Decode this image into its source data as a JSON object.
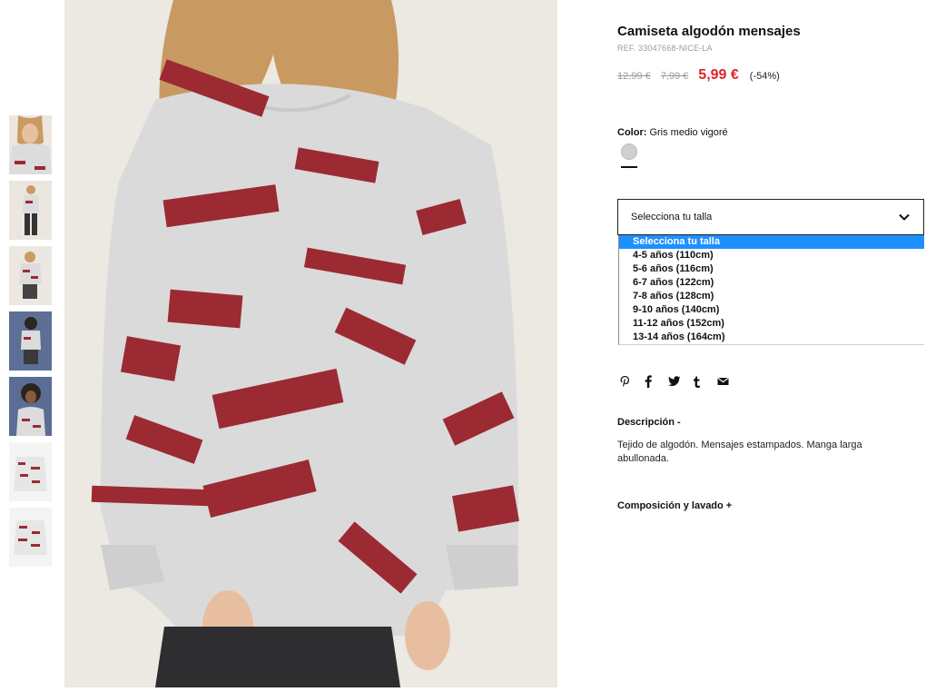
{
  "product": {
    "title": "Camiseta algodón mensajes",
    "ref": "REF. 33047668-NICE-LA",
    "price_original": "12,99 €",
    "price_previous": "7,99 €",
    "price_current": "5,99 €",
    "discount": "(-54%)"
  },
  "color": {
    "label": "Color:",
    "value": "Gris medio vigoré",
    "swatch_color": "#cfcfcf"
  },
  "size": {
    "placeholder": "Selecciona tu talla",
    "options": [
      "Selecciona tu talla",
      "4-5 años (110cm)",
      "5-6 años (116cm)",
      "6-7 años (122cm)",
      "7-8 años (128cm)",
      "9-10 años (140cm)",
      "11-12 años (152cm)",
      "13-14 años (164cm)"
    ],
    "selected_index": 0,
    "highlight_color": "#1e90ff"
  },
  "share": [
    "pinterest-icon",
    "facebook-icon",
    "twitter-icon",
    "tumblr-icon",
    "email-icon"
  ],
  "description": {
    "heading": "Descripción  -",
    "text": "Tejido de algodón. Mensajes estampados. Manga larga abullonada."
  },
  "composition": {
    "heading": "Composición y lavado  +"
  },
  "colors": {
    "sale_price": "#e1242f",
    "print_red": "#9b2a33",
    "fabric_gray": "#d9d9d9"
  }
}
